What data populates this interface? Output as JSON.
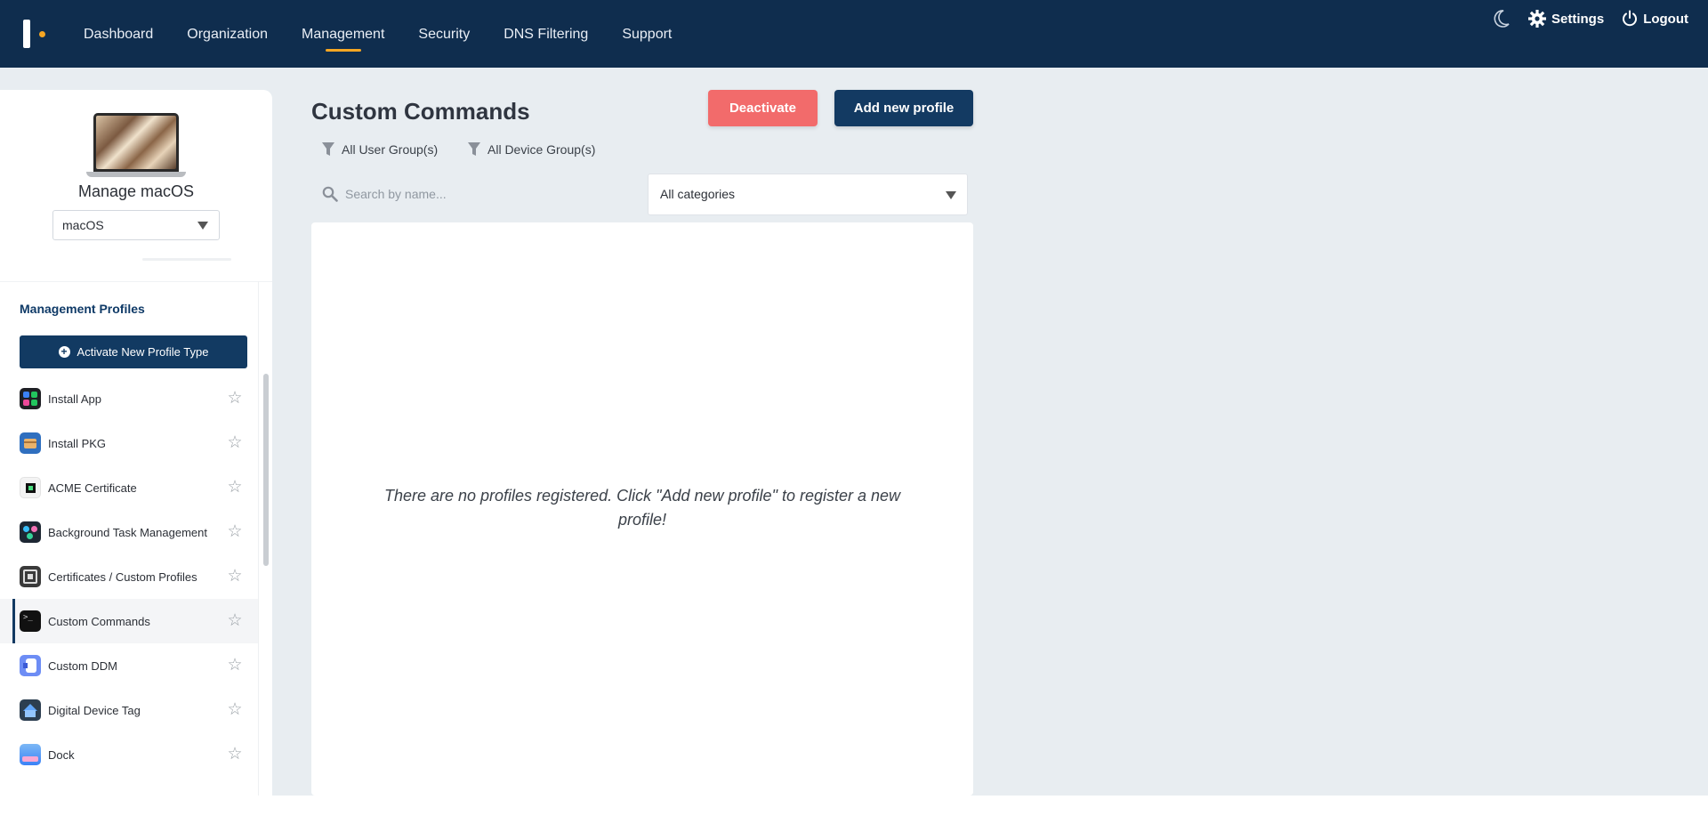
{
  "nav": {
    "items": [
      "Dashboard",
      "Organization",
      "Management",
      "Security",
      "DNS Filtering",
      "Support"
    ],
    "active": "Management",
    "settings_label": "Settings",
    "logout_label": "Logout",
    "icons": [
      "moon-icon",
      "gear-icon",
      "power-icon"
    ]
  },
  "sidebar": {
    "title": "Manage macOS",
    "os_select_value": "macOS",
    "section_title": "Management Profiles",
    "activate_label": "Activate New Profile Type",
    "items": [
      {
        "label": "Install App",
        "icon": "install-app-icon"
      },
      {
        "label": "Install PKG",
        "icon": "install-pkg-icon"
      },
      {
        "label": "ACME Certificate",
        "icon": "acme-certificate-icon"
      },
      {
        "label": "Background Task Management",
        "icon": "background-task-icon"
      },
      {
        "label": "Certificates / Custom Profiles",
        "icon": "certificates-icon"
      },
      {
        "label": "Custom Commands",
        "icon": "terminal-icon"
      },
      {
        "label": "Custom DDM",
        "icon": "custom-ddm-icon"
      },
      {
        "label": "Digital Device Tag",
        "icon": "device-tag-icon"
      },
      {
        "label": "Dock",
        "icon": "dock-icon"
      }
    ],
    "active_item": "Custom Commands"
  },
  "main": {
    "title": "Custom Commands",
    "deactivate_label": "Deactivate",
    "add_label": "Add new profile",
    "filter_user_groups": "All User Group(s)",
    "filter_device_groups": "All Device Group(s)",
    "search_placeholder": "Search by name...",
    "category_value": "All categories",
    "empty_message": "There are no profiles registered. Click \"Add new profile\" to register a new profile!"
  },
  "colors": {
    "topbar": "#0f2d4e",
    "accent": "#f5a623",
    "primary_button": "#133a62",
    "danger_button": "#f26b6b",
    "workspace_bg": "#e8edf1"
  }
}
